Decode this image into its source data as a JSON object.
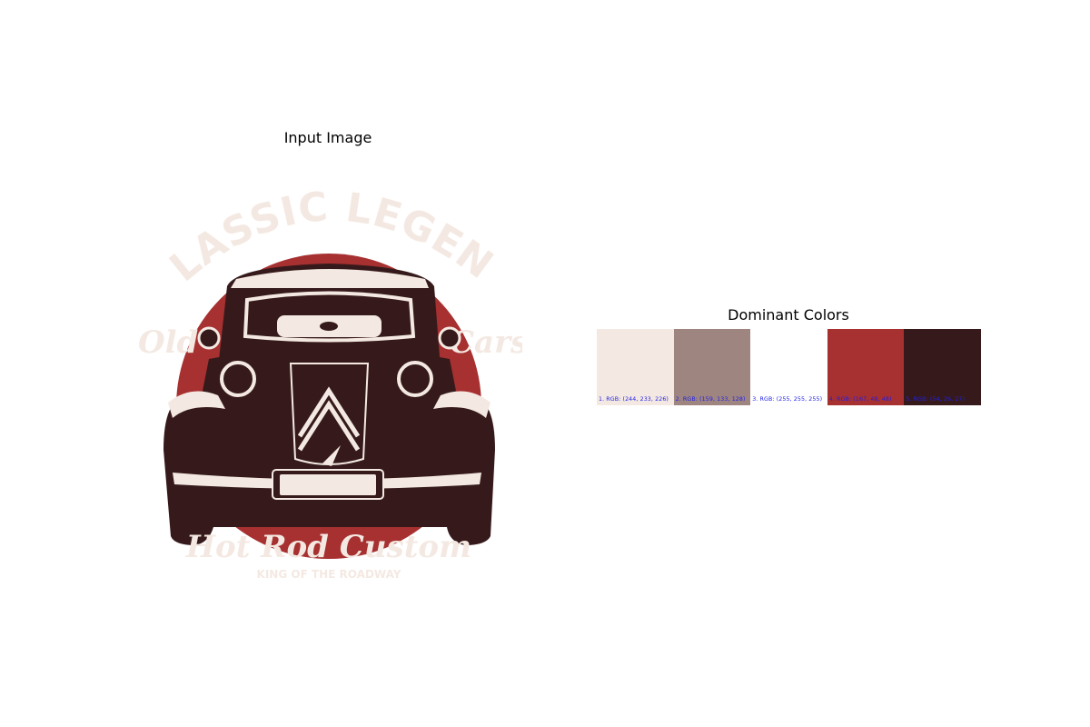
{
  "panels": {
    "input_title": "Input Image",
    "colors_title": "Dominant Colors"
  },
  "artwork": {
    "top_text": "CLASSIC LEGEND",
    "side_text": "Old Cars",
    "script_text": "Hot Rod Custom",
    "bottom_text": "KING OF THE ROADWAY",
    "colors": {
      "light": "#f4e9e2",
      "red": "#a73030",
      "dark": "#361a1b"
    }
  },
  "dominant_colors": [
    {
      "label": "1. RGB: (244, 233, 226)",
      "hex": "#f4e9e2"
    },
    {
      "label": "2. RGB: (159, 133, 128)",
      "hex": "#9f8580"
    },
    {
      "label": "3. RGB: (255, 255, 255)",
      "hex": "#ffffff"
    },
    {
      "label": "4. RGB: (167, 48, 48)",
      "hex": "#a73030"
    },
    {
      "label": "5. RGB: (54, 26, 27)",
      "hex": "#361a1b"
    }
  ]
}
